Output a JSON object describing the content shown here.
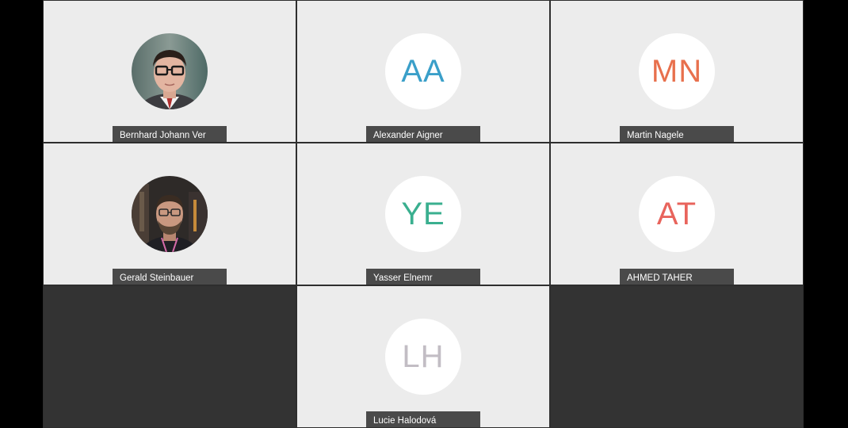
{
  "participants": [
    {
      "name": "Bernhard Johann Ver",
      "initials": "",
      "avatar": "photo-man-glasses"
    },
    {
      "name": "Alexander Aigner",
      "initials": "AA",
      "color": "#3a9fc9"
    },
    {
      "name": "Martin Nagele",
      "initials": "MN",
      "color": "#e8704d"
    },
    {
      "name": "Gerald Steinbauer",
      "initials": "",
      "avatar": "photo-man-beard"
    },
    {
      "name": "Yasser Elnemr",
      "initials": "YE",
      "color": "#3aaf8f"
    },
    {
      "name": "AHMED TAHER",
      "initials": "AT",
      "color": "#e8645c"
    },
    {
      "name": "Lucie Halodová",
      "initials": "LH",
      "color": "#c2bdc4"
    }
  ],
  "colors": {
    "tile_background": "#ececec",
    "empty_tile": "#333333",
    "name_tag": "#4a4a4a",
    "outer_background": "#000000"
  }
}
